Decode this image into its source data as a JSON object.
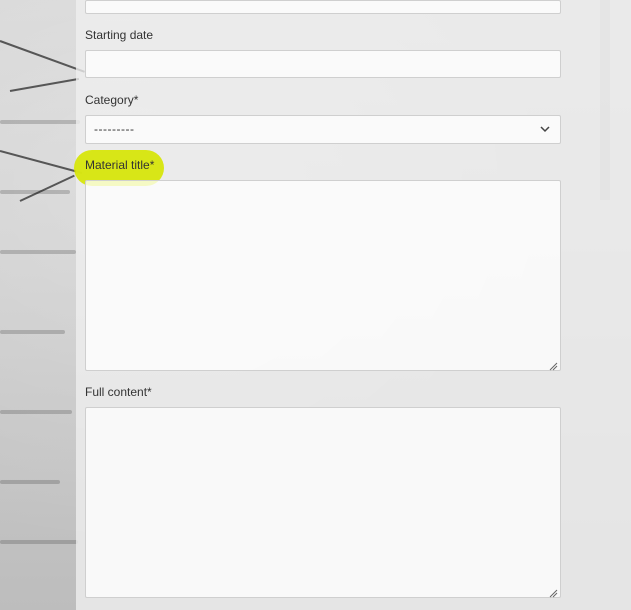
{
  "form": {
    "starting_date": {
      "label": "Starting date",
      "value": ""
    },
    "category": {
      "label": "Category*",
      "selected": "---------",
      "icon": "chevron-down-icon"
    },
    "material_title": {
      "label": "Material title*",
      "value": "",
      "highlight_color": "#d6e600"
    },
    "full_content": {
      "label": "Full content*",
      "value": ""
    }
  }
}
